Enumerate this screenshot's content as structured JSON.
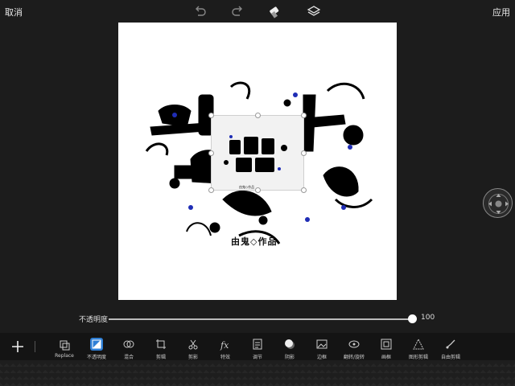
{
  "topbar": {
    "cancel_label": "取消",
    "apply_label": "应用",
    "icons": [
      "undo-icon",
      "redo-icon",
      "eraser-icon",
      "layers-icon"
    ]
  },
  "canvas": {
    "caption": "由鬼◇作品",
    "inner_caption": "由鬼◇作品"
  },
  "opacity": {
    "label": "不透明度",
    "value": "100",
    "level": 1.0
  },
  "toolbar": {
    "tools": [
      {
        "label": "Replace",
        "icon": "replace-icon"
      },
      {
        "label": "不透明度",
        "icon": "opacity-icon",
        "active": true
      },
      {
        "label": "混合",
        "icon": "blend-icon"
      },
      {
        "label": "剪辑",
        "icon": "crop-icon"
      },
      {
        "label": "剪影",
        "icon": "cutout-icon"
      },
      {
        "label": "特效",
        "icon": "fx-icon"
      },
      {
        "label": "调节",
        "icon": "adjust-icon"
      },
      {
        "label": "阴影",
        "icon": "shadow-icon"
      },
      {
        "label": "边框",
        "icon": "border-icon"
      },
      {
        "label": "翻转/旋转",
        "icon": "flip-rotate-icon"
      },
      {
        "label": "画框",
        "icon": "frame-icon"
      },
      {
        "label": "图形剪辑",
        "icon": "shape-crop-icon"
      },
      {
        "label": "自由剪辑",
        "icon": "free-crop-icon"
      }
    ]
  },
  "colors": {
    "background": "#1c1c1c",
    "accent": "#2f7fd6",
    "art_accent": "#1f2db5"
  }
}
